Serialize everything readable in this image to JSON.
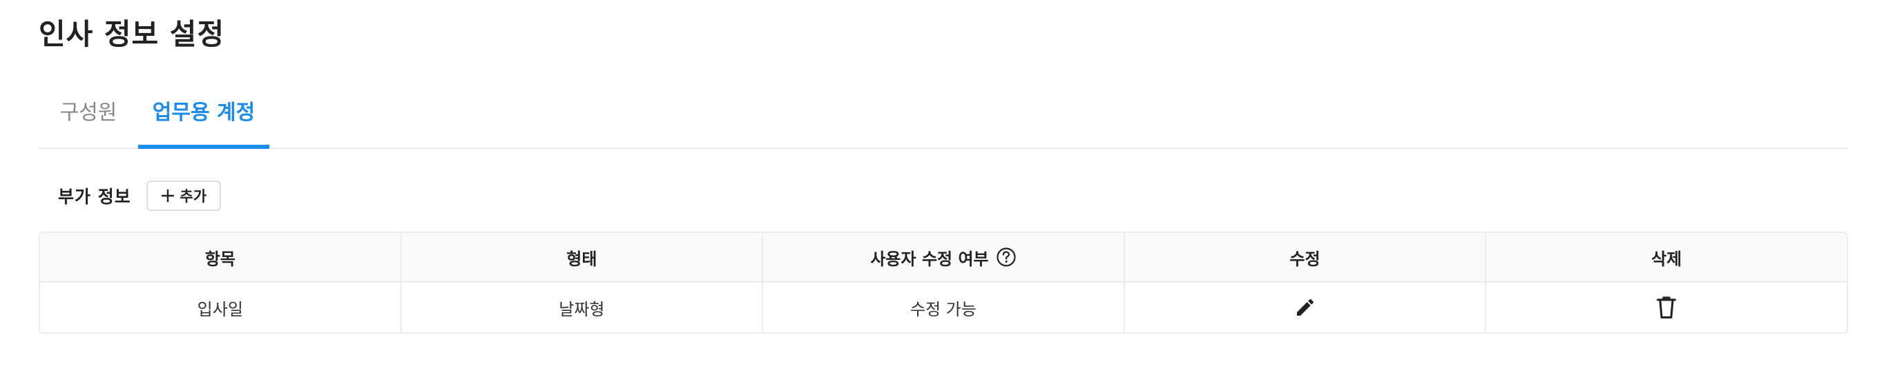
{
  "page": {
    "title": "인사 정보 설정"
  },
  "tabs": [
    {
      "label": "구성원",
      "active": false
    },
    {
      "label": "업무용 계정",
      "active": true
    }
  ],
  "section": {
    "label": "부가 정보",
    "add_label": "추가"
  },
  "table": {
    "columns": [
      "항목",
      "형태",
      "사용자 수정 여부",
      "수정",
      "삭제"
    ],
    "rows": [
      {
        "item": "입사일",
        "type": "날짜형",
        "user_editable": "수정 가능",
        "edit_icon": "pencil-icon",
        "delete_icon": "trash-icon"
      }
    ]
  },
  "colors": {
    "accent": "#1a8cf0",
    "border": "#ececec",
    "header_bg": "#fafafa"
  }
}
